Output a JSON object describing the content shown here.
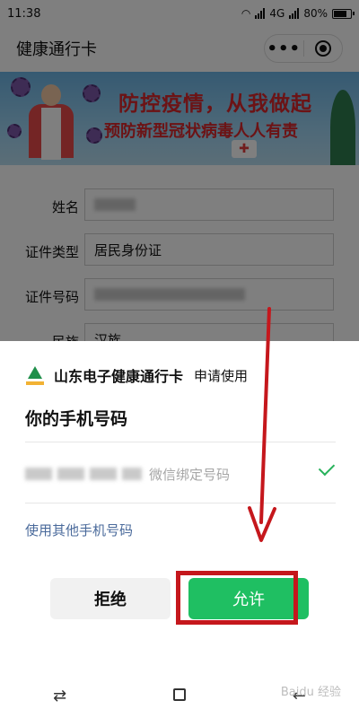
{
  "status_bar": {
    "time": "11:38",
    "network": "4G",
    "battery": "80%",
    "battery_level": 0.8
  },
  "nav": {
    "title": "健康通行卡",
    "more_glyph": "•••",
    "icons": [
      "more-icon",
      "close-target-icon"
    ]
  },
  "banner": {
    "line1": "防控疫情，从我做起",
    "line2": "预防新型冠状病毒人人有责"
  },
  "form": {
    "rows": [
      {
        "label": "姓名",
        "value": ""
      },
      {
        "label": "证件类型",
        "value": "居民身份证"
      },
      {
        "label": "证件号码",
        "value": ""
      },
      {
        "label": "民族",
        "value": "汉族"
      }
    ]
  },
  "sheet": {
    "app_name": "山东电子健康通行卡",
    "request_text": "申请使用",
    "title": "你的手机号码",
    "phone_note": "微信绑定号码",
    "other_phone": "使用其他手机号码",
    "reject_label": "拒绝",
    "allow_label": "允许"
  },
  "watermark": "Baidu 经验",
  "colors": {
    "accent_green": "#1fbf62",
    "check_green": "#28b25b",
    "link_blue": "#4a6a9b",
    "annotation_red": "#c5171c"
  }
}
